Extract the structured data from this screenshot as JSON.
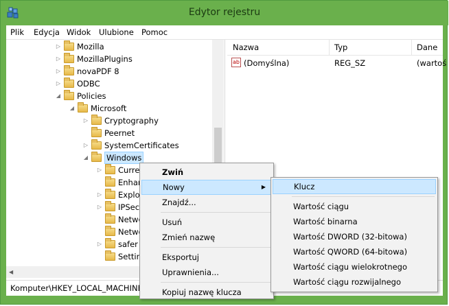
{
  "window": {
    "title": "Edytor rejestru"
  },
  "menubar": [
    "Plik",
    "Edycja",
    "Widok",
    "Ulubione",
    "Pomoc"
  ],
  "tree": [
    {
      "label": "Mozilla",
      "indent": 0,
      "arrow": "▷"
    },
    {
      "label": "MozillaPlugins",
      "indent": 0,
      "arrow": "▷"
    },
    {
      "label": "novaPDF 8",
      "indent": 0,
      "arrow": "▷"
    },
    {
      "label": "ODBC",
      "indent": 0,
      "arrow": "▷"
    },
    {
      "label": "Policies",
      "indent": 0,
      "arrow": "◢"
    },
    {
      "label": "Microsoft",
      "indent": 1,
      "arrow": "◢"
    },
    {
      "label": "Cryptography",
      "indent": 2,
      "arrow": "▷"
    },
    {
      "label": "Peernet",
      "indent": 2,
      "arrow": ""
    },
    {
      "label": "SystemCertificates",
      "indent": 2,
      "arrow": "▷"
    },
    {
      "label": "Windows",
      "indent": 2,
      "arrow": "◢",
      "selected": true
    },
    {
      "label": "Curren",
      "indent": 3,
      "arrow": "▷"
    },
    {
      "label": "Enhan",
      "indent": 3,
      "arrow": ""
    },
    {
      "label": "Explor",
      "indent": 3,
      "arrow": "▷"
    },
    {
      "label": "IPSec",
      "indent": 3,
      "arrow": "▷"
    },
    {
      "label": "Netwo",
      "indent": 3,
      "arrow": ""
    },
    {
      "label": "Netwo",
      "indent": 3,
      "arrow": ""
    },
    {
      "label": "safer",
      "indent": 3,
      "arrow": "▷"
    },
    {
      "label": "Settin",
      "indent": 3,
      "arrow": ""
    }
  ],
  "list": {
    "columns": [
      "Nazwa",
      "Typ",
      "Dane"
    ],
    "rows": [
      {
        "name": "(Domyślna)",
        "type": "REG_SZ",
        "data": "(wartoś"
      }
    ]
  },
  "status": {
    "path": "Komputer\\HKEY_LOCAL_MACHINE"
  },
  "context_menu": {
    "items": [
      {
        "label": "Zwiń",
        "bold": true
      },
      {
        "label": "Nowy",
        "submenu": true,
        "highlight": true
      },
      {
        "label": "Znajdź..."
      },
      {
        "sep": true
      },
      {
        "label": "Usuń"
      },
      {
        "label": "Zmień nazwę"
      },
      {
        "sep": true
      },
      {
        "label": "Eksportuj"
      },
      {
        "label": "Uprawnienia..."
      },
      {
        "sep": true
      },
      {
        "label": "Kopiuj nazwę klucza"
      }
    ]
  },
  "submenu": {
    "items": [
      {
        "label": "Klucz",
        "highlight": true
      },
      {
        "sep": true
      },
      {
        "label": "Wartość ciągu"
      },
      {
        "label": "Wartość binarna"
      },
      {
        "label": "Wartość DWORD (32-bitowa)"
      },
      {
        "label": "Wartość QWORD (64-bitowa)"
      },
      {
        "label": "Wartość ciągu wielokrotnego"
      },
      {
        "label": "Wartość ciągu rozwijalnego"
      }
    ]
  },
  "colors": {
    "titlebar": "#6ab04c",
    "highlight": "#cce8ff",
    "highlight_border": "#99d1ff"
  }
}
